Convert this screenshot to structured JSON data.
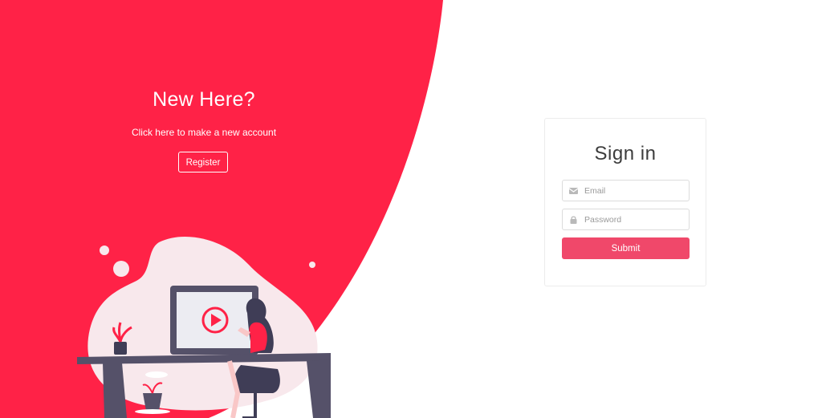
{
  "promo": {
    "title": "New Here?",
    "subtitle": "Click here to make a new account",
    "register_label": "Register"
  },
  "signin": {
    "title": "Sign in",
    "email_placeholder": "Email",
    "password_placeholder": "Password",
    "submit_label": "Submit"
  },
  "colors": {
    "accent": "#ff2247",
    "button": "#f0486a",
    "desk": "#555169",
    "blob": "#f8e8ec"
  },
  "icons": [
    "envelope-icon",
    "lock-icon",
    "play-icon"
  ]
}
